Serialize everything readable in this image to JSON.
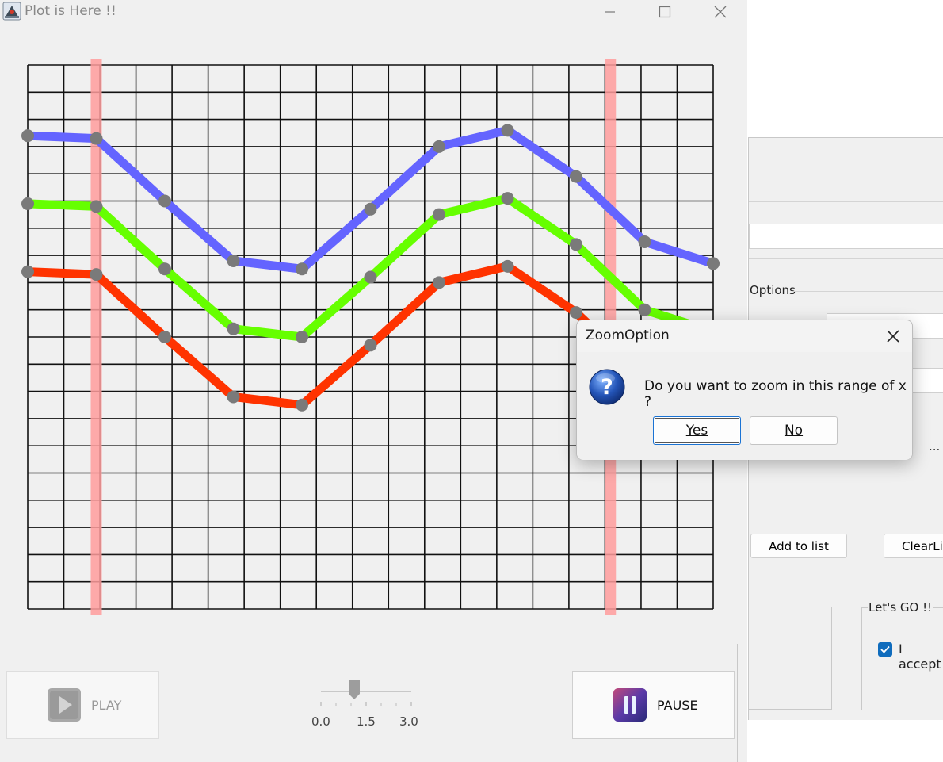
{
  "main_window": {
    "title": "Plot is Here !!",
    "controls": {
      "minimize_icon": "minimize-icon",
      "maximize_icon": "maximize-icon",
      "close_icon": "close-icon"
    }
  },
  "chart_data": {
    "type": "line",
    "grid": true,
    "grid_columns": 19,
    "grid_rows": 20,
    "x": [
      0,
      1,
      2,
      3,
      4,
      5,
      6,
      7,
      8,
      9,
      10
    ],
    "series": [
      {
        "color": "#6464ff",
        "values": [
          17.4,
          17.3,
          15.0,
          12.8,
          12.5,
          14.7,
          17.0,
          17.6,
          15.9,
          13.5,
          12.7
        ]
      },
      {
        "color": "#66ff00",
        "values": [
          14.9,
          14.8,
          12.5,
          10.3,
          10.0,
          12.2,
          14.5,
          15.1,
          13.4,
          11.0,
          10.2
        ]
      },
      {
        "color": "#ff3300",
        "values": [
          12.4,
          12.3,
          10.0,
          7.8,
          7.5,
          9.7,
          12.0,
          12.6,
          10.9,
          8.5,
          7.7
        ]
      }
    ],
    "selection_markers_x": [
      1,
      8.5
    ],
    "selection_color": "#ff9c9c",
    "point_color": "#7a7a7a",
    "xlim": [
      0,
      10
    ],
    "ylim": [
      0,
      20
    ]
  },
  "controls": {
    "play_label": "PLAY",
    "pause_label": "PAUSE",
    "play_icon": "play-icon",
    "pause_icon": "pause-icon",
    "slider": {
      "ticks": [
        "0.0",
        "1.5",
        "3.0"
      ],
      "value": 1.3,
      "min": 0.0,
      "max": 3.0
    }
  },
  "background_window": {
    "options_label": "Options",
    "add_button": "Add to list",
    "clear_button": "ClearLi",
    "group_label": "Let's GO !!",
    "checkbox_label": "I accept",
    "checkbox_checked": true,
    "ellipsis": "..."
  },
  "dialog": {
    "title": "ZoomOption",
    "message": "Do you want to zoom in this range of x ?",
    "yes_label": "Yes",
    "no_label": "No",
    "icon": "question-icon"
  }
}
